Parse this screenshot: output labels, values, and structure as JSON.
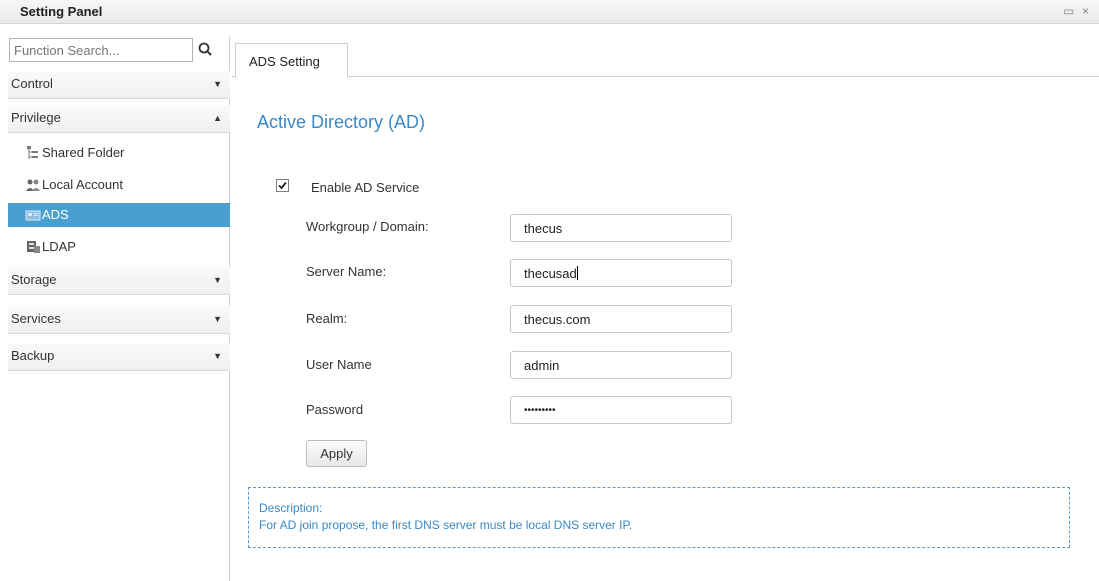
{
  "window": {
    "title": "Setting Panel",
    "restore_glyph": "▭",
    "close_glyph": "×"
  },
  "sidebar": {
    "search_placeholder": "Function Search...",
    "categories": [
      {
        "label": "Control",
        "arrow": "▼"
      },
      {
        "label": "Privilege",
        "arrow": "▲"
      },
      {
        "label": "Storage",
        "arrow": "▼"
      },
      {
        "label": "Services",
        "arrow": "▼"
      },
      {
        "label": "Backup",
        "arrow": "▼"
      }
    ],
    "privilege_items": [
      {
        "label": "Shared Folder",
        "icon": "shared-folder-icon"
      },
      {
        "label": "Local Account",
        "icon": "local-account-icon"
      },
      {
        "label": "ADS",
        "icon": "ads-icon",
        "active": true
      },
      {
        "label": "LDAP",
        "icon": "ldap-icon"
      }
    ]
  },
  "tabs": [
    {
      "label": "ADS Setting",
      "active": true
    }
  ],
  "main": {
    "section_title": "Active Directory (AD)",
    "enable_label": "Enable AD Service",
    "enable_checked": true,
    "fields": [
      {
        "label": "Workgroup / Domain:",
        "value": "thecus"
      },
      {
        "label": "Server Name:",
        "value": "thecusad"
      },
      {
        "label": "Realm:",
        "value": "thecus.com"
      },
      {
        "label": "User Name",
        "value": "admin"
      },
      {
        "label": "Password",
        "value": "•••••••••"
      }
    ],
    "apply_label": "Apply",
    "description_title": "Description:",
    "description_text": "For AD join propose, the first DNS server must be local DNS server IP."
  },
  "colors": {
    "accent": "#3a88c4",
    "active_item": "#4a9fd1"
  }
}
